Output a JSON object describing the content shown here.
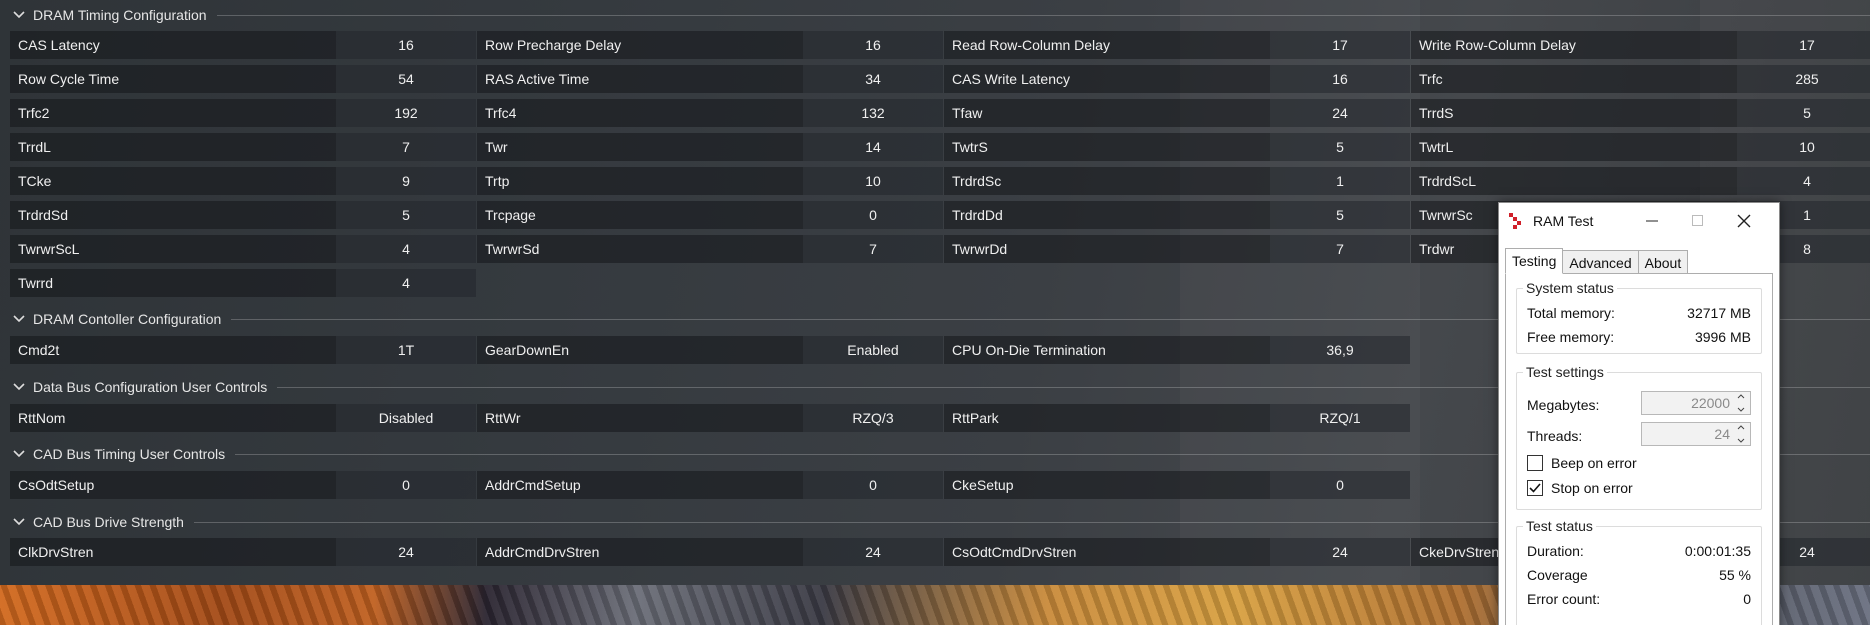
{
  "sections": {
    "dram_timing": {
      "title": "DRAM Timing Configuration"
    },
    "dram_controller": {
      "title": "DRAM Contoller Configuration"
    },
    "data_bus": {
      "title": "Data Bus Configuration User Controls"
    },
    "cad_timing": {
      "title": "CAD Bus Timing User Controls"
    },
    "cad_drive": {
      "title": "CAD Bus Drive Strength"
    }
  },
  "timings": [
    {
      "name": "CAS Latency",
      "value": "16"
    },
    {
      "name": "Row Precharge Delay",
      "value": "16"
    },
    {
      "name": "Read Row-Column Delay",
      "value": "17"
    },
    {
      "name": "Write Row-Column Delay",
      "value": "17"
    },
    {
      "name": "Row Cycle Time",
      "value": "54"
    },
    {
      "name": "RAS Active Time",
      "value": "34"
    },
    {
      "name": "CAS Write Latency",
      "value": "16"
    },
    {
      "name": "Trfc",
      "value": "285"
    },
    {
      "name": "Trfc2",
      "value": "192"
    },
    {
      "name": "Trfc4",
      "value": "132"
    },
    {
      "name": "Tfaw",
      "value": "24"
    },
    {
      "name": "TrrdS",
      "value": "5"
    },
    {
      "name": "TrrdL",
      "value": "7"
    },
    {
      "name": "Twr",
      "value": "14"
    },
    {
      "name": "TwtrS",
      "value": "5"
    },
    {
      "name": "TwtrL",
      "value": "10"
    },
    {
      "name": "TCke",
      "value": "9"
    },
    {
      "name": "Trtp",
      "value": "10"
    },
    {
      "name": "TrdrdSc",
      "value": "1"
    },
    {
      "name": "TrdrdScL",
      "value": "4"
    },
    {
      "name": "TrdrdSd",
      "value": "5"
    },
    {
      "name": "Trcpage",
      "value": "0"
    },
    {
      "name": "TrdrdDd",
      "value": "5"
    },
    {
      "name": "TwrwrSc",
      "value": "1"
    },
    {
      "name": "TwrwrScL",
      "value": "4"
    },
    {
      "name": "TwrwrSd",
      "value": "7"
    },
    {
      "name": "TwrwrDd",
      "value": "7"
    },
    {
      "name": "Trdwr",
      "value": "8"
    },
    {
      "name": "Twrrd",
      "value": "4"
    }
  ],
  "controller": [
    {
      "name": "Cmd2t",
      "value": "1T"
    },
    {
      "name": "GearDownEn",
      "value": "Enabled"
    },
    {
      "name": "CPU On-Die Termination",
      "value": "36,9"
    }
  ],
  "data_bus": [
    {
      "name": "RttNom",
      "value": "Disabled"
    },
    {
      "name": "RttWr",
      "value": "RZQ/3"
    },
    {
      "name": "RttPark",
      "value": "RZQ/1"
    }
  ],
  "cad_timing": [
    {
      "name": "CsOdtSetup",
      "value": "0"
    },
    {
      "name": "AddrCmdSetup",
      "value": "0"
    },
    {
      "name": "CkeSetup",
      "value": "0"
    }
  ],
  "cad_drive": [
    {
      "name": "ClkDrvStren",
      "value": "24"
    },
    {
      "name": "AddrCmdDrvStren",
      "value": "24"
    },
    {
      "name": "CsOdtCmdDrvStren",
      "value": "24"
    },
    {
      "name": "CkeDrvStren",
      "value": "24"
    }
  ],
  "ramtest": {
    "title": "RAM Test",
    "tabs": [
      "Testing",
      "Advanced",
      "About"
    ],
    "system_status": {
      "title": "System status",
      "total_label": "Total memory:",
      "total_value": "32717 MB",
      "free_label": "Free memory:",
      "free_value": "3996 MB"
    },
    "test_settings": {
      "title": "Test settings",
      "megabytes_label": "Megabytes:",
      "megabytes_value": "22000",
      "threads_label": "Threads:",
      "threads_value": "24",
      "beep_label": "Beep on error",
      "beep_checked": false,
      "stop_label": "Stop on error",
      "stop_checked": true
    },
    "test_status": {
      "title": "Test status",
      "duration_label": "Duration:",
      "duration_value": "0:00:01:35",
      "coverage_label": "Coverage",
      "coverage_value": "55 %",
      "errors_label": "Error count:",
      "errors_value": "0"
    }
  }
}
